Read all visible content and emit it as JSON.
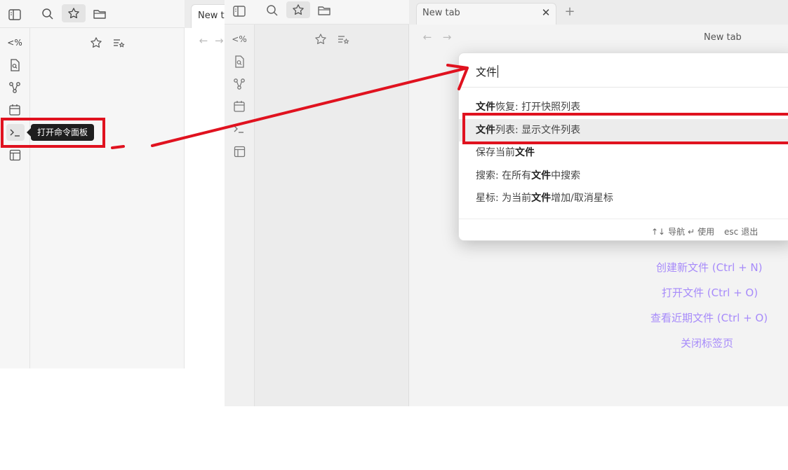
{
  "left_window": {
    "tab_label": "New tab",
    "tooltip": "打开命令面板",
    "ribbon_icons": [
      "code-icon",
      "file-search-icon",
      "graph-icon",
      "calendar-icon",
      "terminal-icon",
      "template-icon"
    ],
    "ribbon_code_label": "<%"
  },
  "right_window": {
    "tab_label": "New tab",
    "view_title": "New tab",
    "ribbon_code_label": "<%",
    "empty_actions": [
      "创建新文件 (Ctrl + N)",
      "打开文件 (Ctrl + O)",
      "查看近期文件 (Ctrl + O)",
      "关闭标签页"
    ]
  },
  "palette": {
    "query": "文件",
    "items": [
      {
        "bold": "文件",
        "rest": "恢复: 打开快照列表"
      },
      {
        "bold": "文件",
        "rest": "列表: 显示文件列表"
      },
      {
        "pre": "保存当前",
        "bold": "文件"
      },
      {
        "pre": "搜索: 在所有",
        "bold": "文件",
        "rest": "中搜索"
      },
      {
        "pre": "星标: 为当前",
        "bold": "文件",
        "rest": "增加/取消星标"
      }
    ],
    "footer": {
      "navigate_key": "↑↓",
      "navigate": "导航",
      "use_key": "↵",
      "use": "使用",
      "exit_key": "esc",
      "exit": "退出"
    }
  },
  "colors": {
    "annotation_red": "#e0121f",
    "link_purple": "#a78bfa"
  }
}
